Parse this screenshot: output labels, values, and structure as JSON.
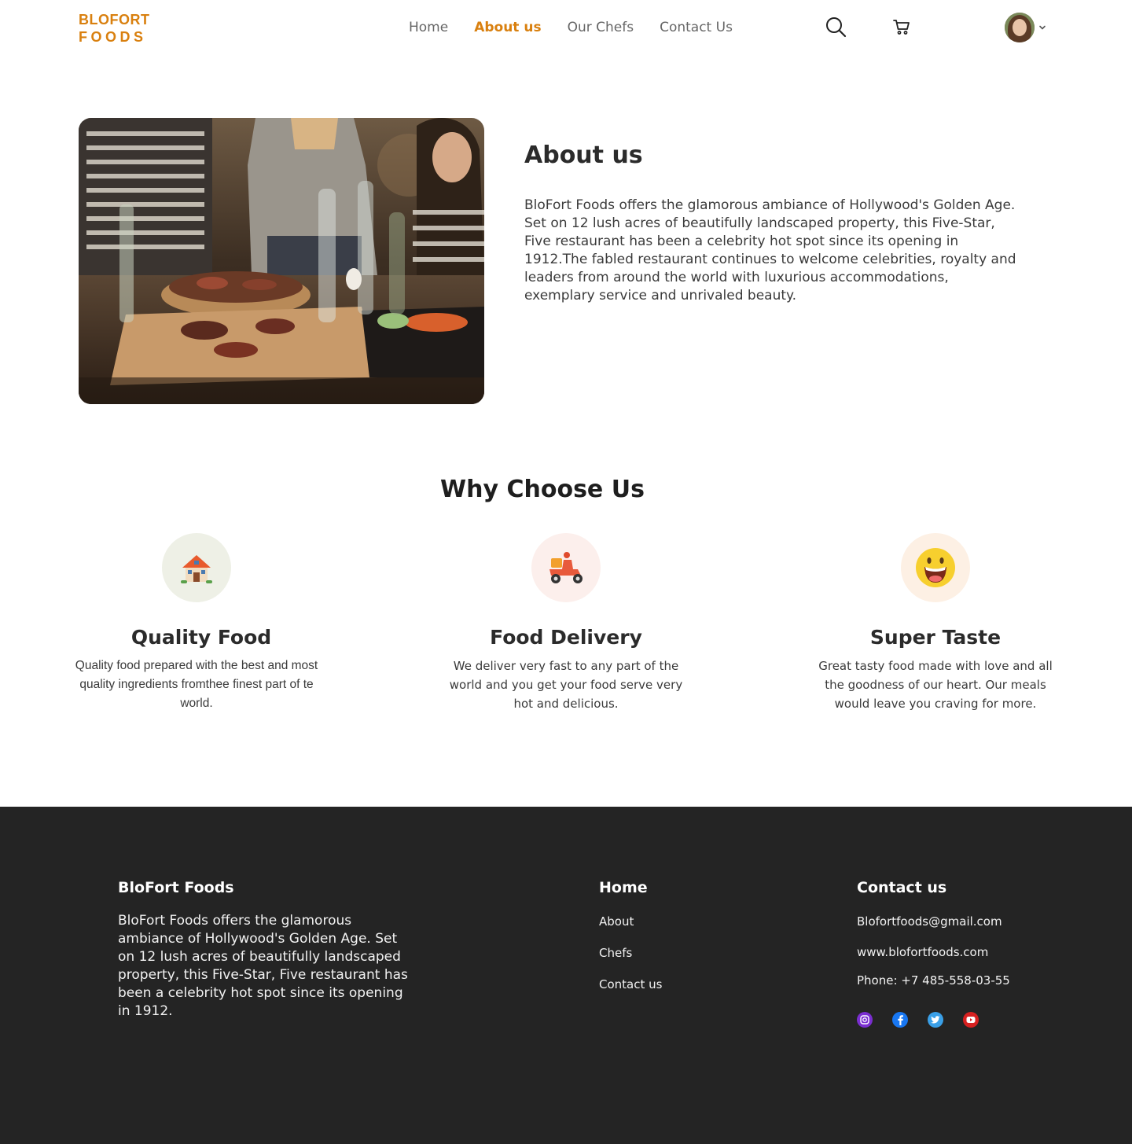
{
  "header": {
    "logo_line1": "BLOFORT",
    "logo_line2": "FOODS",
    "nav": [
      {
        "label": "Home"
      },
      {
        "label": "About us",
        "active": true
      },
      {
        "label": "Our Chefs"
      },
      {
        "label": "Contact Us"
      }
    ],
    "icons": [
      "search-icon",
      "cart-icon",
      "avatar",
      "chevron-down-icon"
    ]
  },
  "about": {
    "title": "About us",
    "text": "BloFort Foods offers the glamorous ambiance of Hollywood's Golden Age. Set on 12 lush acres of beautifully landscaped property, this Five-Star, Five restaurant has been a celebrity hot spot since its opening in 1912.The fabled restaurant continues to welcome celebrities, royalty and leaders from around the world with luxurious accommodations, exemplary service and unrivaled beauty."
  },
  "why": {
    "title": "Why Choose Us",
    "features": [
      {
        "title": "Quality Food",
        "text": "Quality food prepared with the best and most quality ingredients fromthee finest part of te world.",
        "icon": "house-icon"
      },
      {
        "title": "Food Delivery",
        "text": "We deliver very fast to any part of the world and you get your food serve very hot and delicious.",
        "icon": "delivery-scooter-icon"
      },
      {
        "title": "Super Taste",
        "text": "Great tasty food made with love and all the goodness of our heart. Our meals would leave you craving for more.",
        "icon": "smiley-face-icon"
      }
    ]
  },
  "footer": {
    "brand_title": "BloFort Foods",
    "brand_text": "BloFort Foods offers the glamorous ambiance of Hollywood's Golden Age. Set on 12 lush acres of beautifully landscaped property, this Five-Star, Five restaurant has been a celebrity hot spot since its opening in 1912.",
    "home_title": "Home",
    "home_links": [
      "About",
      "Chefs",
      "Contact us"
    ],
    "contact_title": "Contact us",
    "email": "Blofortfoods@gmail.com",
    "website": "www.blofortfoods.com",
    "phone": "Phone: +7 485-558-03-55",
    "socials": [
      "instagram-icon",
      "facebook-icon",
      "twitter-icon",
      "youtube-icon"
    ]
  },
  "colors": {
    "accent": "#d9800f",
    "footer_bg": "#242424"
  }
}
